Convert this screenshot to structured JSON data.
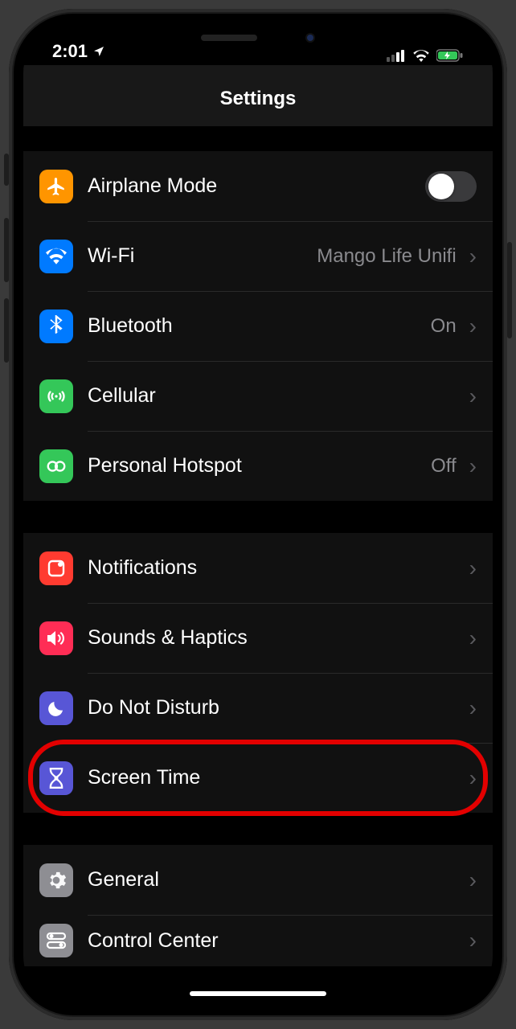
{
  "status": {
    "time": "2:01"
  },
  "header": {
    "title": "Settings"
  },
  "groups": [
    {
      "rows": [
        {
          "label": "Airplane Mode",
          "detail": "",
          "control": "toggle"
        },
        {
          "label": "Wi-Fi",
          "detail": "Mango Life Unifi",
          "control": "chevron"
        },
        {
          "label": "Bluetooth",
          "detail": "On",
          "control": "chevron"
        },
        {
          "label": "Cellular",
          "detail": "",
          "control": "chevron"
        },
        {
          "label": "Personal Hotspot",
          "detail": "Off",
          "control": "chevron"
        }
      ]
    },
    {
      "rows": [
        {
          "label": "Notifications",
          "detail": "",
          "control": "chevron"
        },
        {
          "label": "Sounds & Haptics",
          "detail": "",
          "control": "chevron"
        },
        {
          "label": "Do Not Disturb",
          "detail": "",
          "control": "chevron"
        },
        {
          "label": "Screen Time",
          "detail": "",
          "control": "chevron",
          "highlighted": true
        }
      ]
    },
    {
      "rows": [
        {
          "label": "General",
          "detail": "",
          "control": "chevron"
        },
        {
          "label": "Control Center",
          "detail": "",
          "control": "chevron",
          "partial": true
        }
      ]
    }
  ],
  "icons": {
    "airplane": {
      "bg": "#ff9500"
    },
    "wifi": {
      "bg": "#007aff"
    },
    "bluetooth": {
      "bg": "#007aff"
    },
    "cellular": {
      "bg": "#34c759"
    },
    "hotspot": {
      "bg": "#34c759"
    },
    "notifications": {
      "bg": "#ff3b30"
    },
    "sounds": {
      "bg": "#ff2d55"
    },
    "dnd": {
      "bg": "#5856d6"
    },
    "screentime": {
      "bg": "#5856d6"
    },
    "general": {
      "bg": "#8e8e93"
    },
    "control": {
      "bg": "#8e8e93"
    }
  }
}
